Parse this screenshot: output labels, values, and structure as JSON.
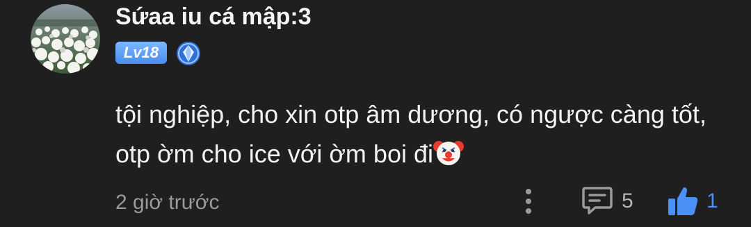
{
  "comment": {
    "username": "Sứaa iu cá mập:3",
    "level_badge": "Lv18",
    "rank_icon": "blue-diamond-rank-icon",
    "avatar": "cotton-grass-field-avatar",
    "text": "tội nghiệp, cho xin otp âm dương, có ngược càng tốt, otp ờm cho ice với ờm boi đi",
    "text_emoji": "clown-face-emoji",
    "timestamp": "2 giờ trước",
    "reply_count": "5",
    "like_count": "1",
    "colors": {
      "background": "#1f1f1f",
      "username": "#f4f4f4",
      "body_text": "#f2f2f2",
      "timestamp": "#9a9a9a",
      "accent_blue": "#4a90f5",
      "level_badge": "#5b9cf5"
    }
  }
}
